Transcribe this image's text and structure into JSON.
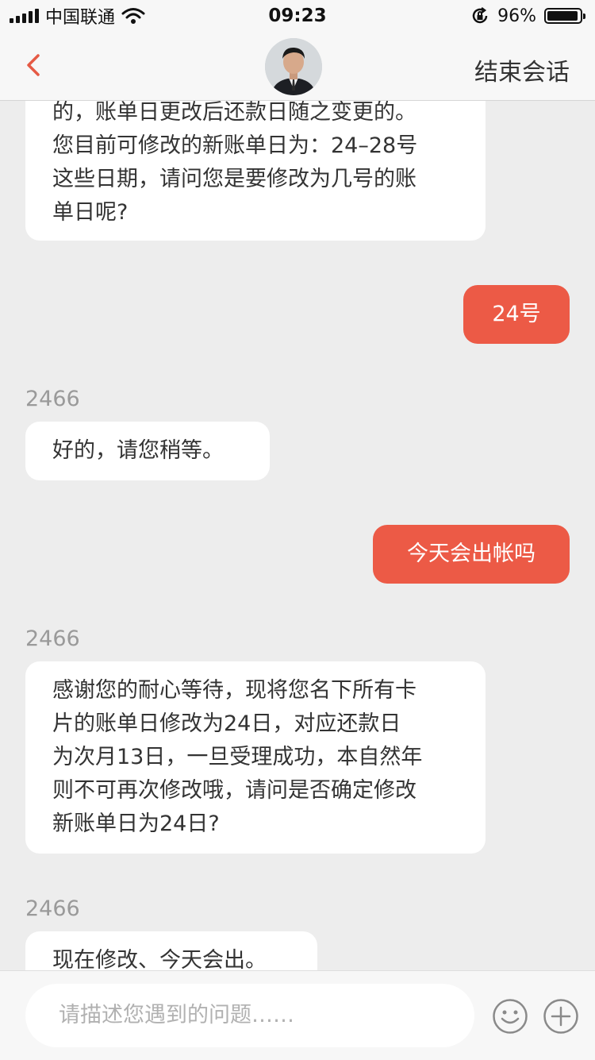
{
  "status_bar": {
    "carrier": "中国联通",
    "time": "09:23",
    "battery": "96%",
    "battery_level": 0.96
  },
  "nav": {
    "back_icon": "chevron-left-icon",
    "end_label": "结束会话",
    "accent_color": "#e55a45"
  },
  "messages": [
    {
      "type": "in",
      "lines": [
        "的，账单日更改后还款日随之变更的。",
        "您目前可修改的新账单日为：24–28号",
        "这些日期，请问您是要修改为几号的账",
        "单日呢?"
      ]
    },
    {
      "type": "out",
      "text": "24号"
    },
    {
      "sender": "2466",
      "type": "in",
      "text": "好的，请您稍等。"
    },
    {
      "type": "out",
      "text": "今天会出帐吗"
    },
    {
      "sender": "2466",
      "type": "in",
      "lines": [
        "感谢您的耐心等待，现将您名下所有卡",
        "片的账单日修改为24日，对应还款日",
        "为次月13日，一旦受理成功，本自然年",
        "则不可再次修改哦，请问是否确定修改",
        "新账单日为24日?"
      ]
    },
    {
      "sender": "2466",
      "type": "in",
      "text": "现在修改、今天会出。"
    }
  ],
  "input": {
    "placeholder": "请描述您遇到的问题……",
    "emoji_icon": "smiley-icon",
    "add_icon": "plus-circle-icon"
  },
  "colors": {
    "outgoing_bubble": "#ec5a46",
    "incoming_bubble": "#ffffff",
    "background": "#ededed"
  }
}
